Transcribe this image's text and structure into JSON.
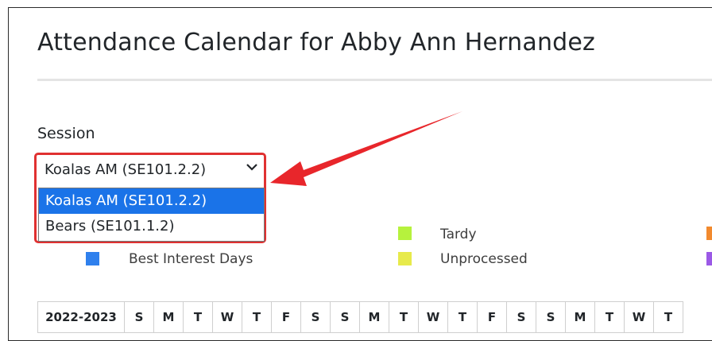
{
  "page": {
    "title": "Attendance Calendar for Abby Ann Hernandez"
  },
  "session": {
    "label": "Session",
    "selected": "Koalas AM (SE101.2.2)",
    "options": [
      "Koalas AM (SE101.2.2)",
      "Bears (SE101.1.2)"
    ]
  },
  "legend": [
    {
      "label": "Best Interest Days",
      "color": "#2f80ed"
    },
    {
      "label": "Tardy",
      "color": "#b6f23d"
    },
    {
      "label": "Unprocessed",
      "color": "#e7ea4b"
    },
    {
      "label": "",
      "color": "#f28a2e"
    },
    {
      "label": "",
      "color": "#9b59e6"
    }
  ],
  "calendar": {
    "year": "2022-2023",
    "day_headers": [
      "S",
      "M",
      "T",
      "W",
      "T",
      "F",
      "S",
      "S",
      "M",
      "T",
      "W",
      "T",
      "F",
      "S",
      "S",
      "M",
      "T",
      "W",
      "T"
    ]
  },
  "colors": {
    "highlight": "#e03131",
    "selected_option": "#1a73e8"
  }
}
